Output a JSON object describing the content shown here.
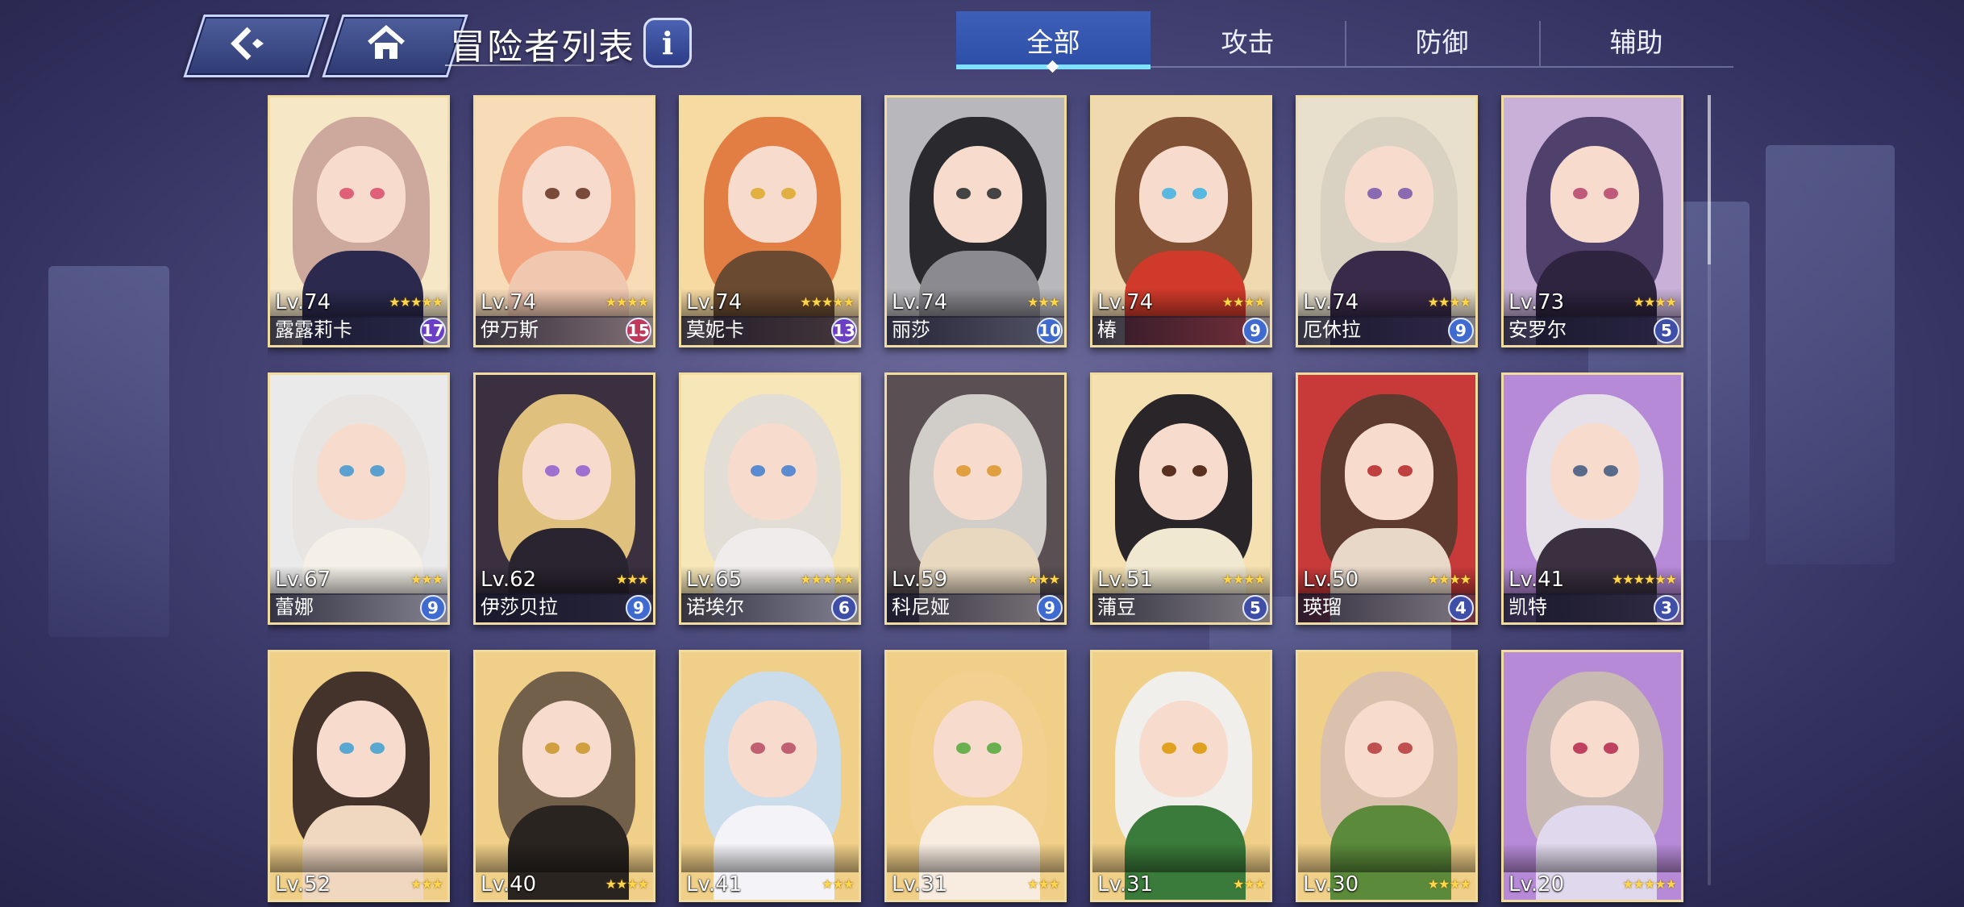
{
  "header": {
    "title": "冒险者列表",
    "info_label": "i"
  },
  "tabs": [
    {
      "label": "全部",
      "active": true
    },
    {
      "label": "攻击",
      "active": false
    },
    {
      "label": "防御",
      "active": false
    },
    {
      "label": "辅助",
      "active": false
    }
  ],
  "colors": {
    "accent": "#7fe0ff",
    "card_border": "#f0dca0",
    "star": "#ffd54a"
  },
  "icons": {
    "back": "back-arrow-icon",
    "home": "home-icon",
    "info": "info-icon",
    "star": "star-icon"
  },
  "adventurers": [
    {
      "level": "Lv.74",
      "stars": 5,
      "name": "露露莉卡",
      "badge": "17",
      "badge_color": "#6a3fc6",
      "bg": "#f6e7c7",
      "hair": "#c9a59a",
      "eye": "#e0607a",
      "body": "#2b2a4e"
    },
    {
      "level": "Lv.74",
      "stars": 4,
      "name": "伊万斯",
      "badge": "15",
      "badge_color": "#c0385a",
      "bg": "#f8dcb8",
      "hair": "#f0a07a",
      "eye": "#7a4a3a",
      "body": "#f0c8b0"
    },
    {
      "level": "Lv.74",
      "stars": 5,
      "name": "莫妮卡",
      "badge": "13",
      "badge_color": "#6a3fc6",
      "bg": "#f7d9a2",
      "hair": "#e0783e",
      "eye": "#e0b040",
      "body": "#6a4a30"
    },
    {
      "level": "Lv.74",
      "stars": 3,
      "name": "丽莎",
      "badge": "10",
      "badge_color": "#3f6ad0",
      "bg": "#b8b8bc",
      "hair": "#222226",
      "eye": "#444",
      "body": "#8a8a90"
    },
    {
      "level": "Lv.74",
      "stars": 4,
      "name": "椿",
      "badge": "9",
      "badge_color": "#3f6ad0",
      "bg": "#f0d8b0",
      "hair": "#7a4a2e",
      "eye": "#58b8e0",
      "body": "#d03a2a"
    },
    {
      "level": "Lv.74",
      "stars": 4,
      "name": "厄休拉",
      "badge": "9",
      "badge_color": "#3f6ad0",
      "bg": "#e8e0cc",
      "hair": "#d8d0c0",
      "eye": "#8a6ab0",
      "body": "#3a2a4a"
    },
    {
      "level": "Lv.73",
      "stars": 4,
      "name": "安罗尔",
      "badge": "5",
      "badge_color": "#3f4fa8",
      "bg": "#c8b0d8",
      "hair": "#4a3a66",
      "eye": "#c05a7a",
      "body": "#2e2440"
    },
    {
      "level": "Lv.67",
      "stars": 3,
      "name": "蕾娜",
      "badge": "9",
      "badge_color": "#3f6ad0",
      "bg": "#eaeaea",
      "hair": "#e8e4e0",
      "eye": "#5aa0d0",
      "body": "#f4f0e8"
    },
    {
      "level": "Lv.62",
      "stars": 3,
      "name": "伊莎贝拉",
      "badge": "9",
      "badge_color": "#3f6ad0",
      "bg": "#3a3040",
      "hair": "#e8c880",
      "eye": "#a070d0",
      "body": "#2a2430"
    },
    {
      "level": "Lv.65",
      "stars": 5,
      "name": "诺埃尔",
      "badge": "6",
      "badge_color": "#3f4fa8",
      "bg": "#f6e6b8",
      "hair": "#e0dcd6",
      "eye": "#5a8ad0",
      "body": "#f0ecec"
    },
    {
      "level": "Lv.59",
      "stars": 3,
      "name": "科尼娅",
      "badge": "9",
      "badge_color": "#3f6ad0",
      "bg": "#5a5054",
      "hair": "#d8d4d0",
      "eye": "#e0a040",
      "body": "#e8d8c0"
    },
    {
      "level": "Lv.51",
      "stars": 4,
      "name": "蒲豆",
      "badge": "5",
      "badge_color": "#3f4fa8",
      "bg": "#f4e0b0",
      "hair": "#1e1a22",
      "eye": "#5a3020",
      "body": "#f0e8d0"
    },
    {
      "level": "Lv.50",
      "stars": 4,
      "name": "瑛瑠",
      "badge": "4",
      "badge_color": "#3f4fa8",
      "bg": "#c83a3a",
      "hair": "#5a3a2e",
      "eye": "#c04040",
      "body": "#e8d8c8"
    },
    {
      "level": "Lv.41",
      "stars": 6,
      "name": "凯特",
      "badge": "3",
      "badge_color": "#3f4fa8",
      "bg": "#b78ad8",
      "hair": "#e8e6ea",
      "eye": "#5a6a8a",
      "body": "#3a3040"
    },
    {
      "level": "Lv.52",
      "stars": 3,
      "name": "",
      "badge": "",
      "badge_color": "#3f4fa8",
      "bg": "#f0cf88",
      "hair": "#3a2a26",
      "eye": "#58a8d0",
      "body": "#f0d8c0"
    },
    {
      "level": "Lv.40",
      "stars": 4,
      "name": "",
      "badge": "",
      "badge_color": "#3f4fa8",
      "bg": "#f0cf88",
      "hair": "#6a5a48",
      "eye": "#d0a040",
      "body": "#2a2420"
    },
    {
      "level": "Lv.41",
      "stars": 3,
      "name": "",
      "badge": "",
      "badge_color": "#3f4fa8",
      "bg": "#f0cf88",
      "hair": "#c8dcef",
      "eye": "#c06070",
      "body": "#f4f4f8"
    },
    {
      "level": "Lv.31",
      "stars": 3,
      "name": "",
      "badge": "",
      "badge_color": "#3f4fa8",
      "bg": "#f0cf88",
      "hair": "#f0d090",
      "eye": "#6ab050",
      "body": "#f8ece0"
    },
    {
      "level": "Lv.31",
      "stars": 3,
      "name": "",
      "badge": "",
      "badge_color": "#3f4fa8",
      "bg": "#f0cf88",
      "hair": "#f0f0f0",
      "eye": "#e0a020",
      "body": "#3a7a3a"
    },
    {
      "level": "Lv.30",
      "stars": 4,
      "name": "",
      "badge": "",
      "badge_color": "#3f4fa8",
      "bg": "#f0cf88",
      "hair": "#d8c0b0",
      "eye": "#c05050",
      "body": "#5a8a3a"
    },
    {
      "level": "Lv.20",
      "stars": 5,
      "name": "",
      "badge": "",
      "badge_color": "#3f4fa8",
      "bg": "#b78ad8",
      "hair": "#c8bcb0",
      "eye": "#c04060",
      "body": "#e0d8ec"
    }
  ]
}
